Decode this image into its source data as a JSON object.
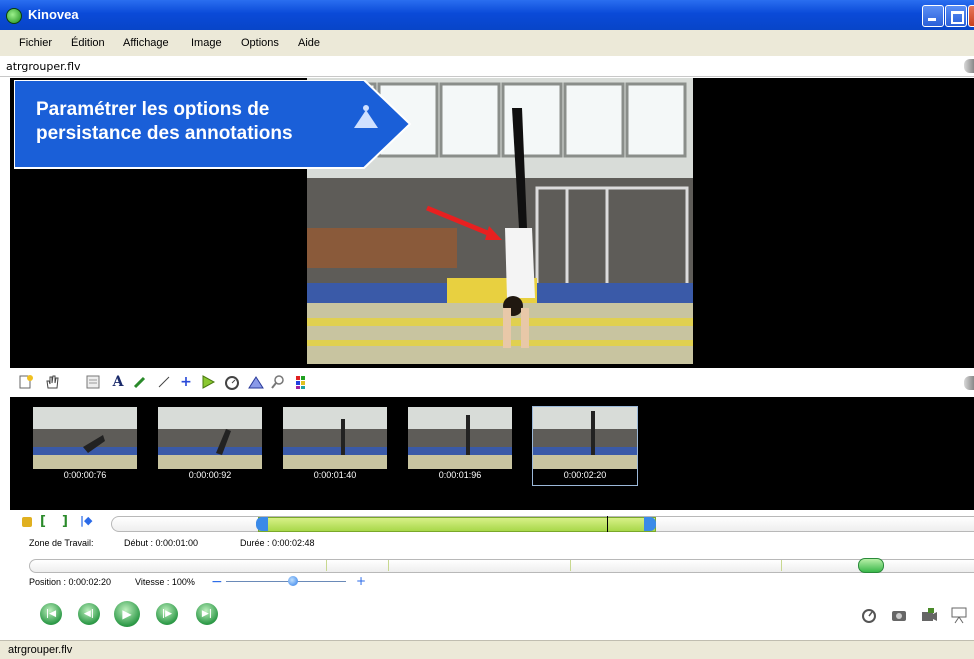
{
  "window": {
    "title": "Kinovea"
  },
  "menu": [
    "Fichier",
    "Édition",
    "Affichage",
    "Image",
    "Options",
    "Aide"
  ],
  "file_tab": {
    "name": "atrgrouper.flv"
  },
  "callout": {
    "text": "Paramétrer les options de persistance des annotations"
  },
  "toolbar_icons": [
    "new-keyframe-icon",
    "hand-icon",
    "whiteboard-icon",
    "text-icon",
    "pencil-icon",
    "line-icon",
    "cross-marker-icon",
    "angle-icon",
    "chrono-icon",
    "grid-icon",
    "magnifier-icon",
    "color-profile-icon"
  ],
  "thumbnails": [
    {
      "time": "0:00:00:76"
    },
    {
      "time": "0:00:00:92"
    },
    {
      "time": "0:00:01:40"
    },
    {
      "time": "0:00:01:96"
    },
    {
      "time": "0:00:02:20",
      "selected": true
    }
  ],
  "working_zone": {
    "label": "Zone de Travail:",
    "start": "Début : 0:00:01:00",
    "duration": "Durée : 0:00:02:48"
  },
  "playback": {
    "position": "Position : 0:00:02:20",
    "speed": "Vitesse : 100%",
    "speed_percent": 100
  },
  "status": {
    "text": "atrgrouper.flv"
  },
  "colors": {
    "titlebar": "#0a4ad8",
    "callout": "#1a5fd8",
    "zone": "#a8d84a",
    "play": "#2e9a48"
  }
}
